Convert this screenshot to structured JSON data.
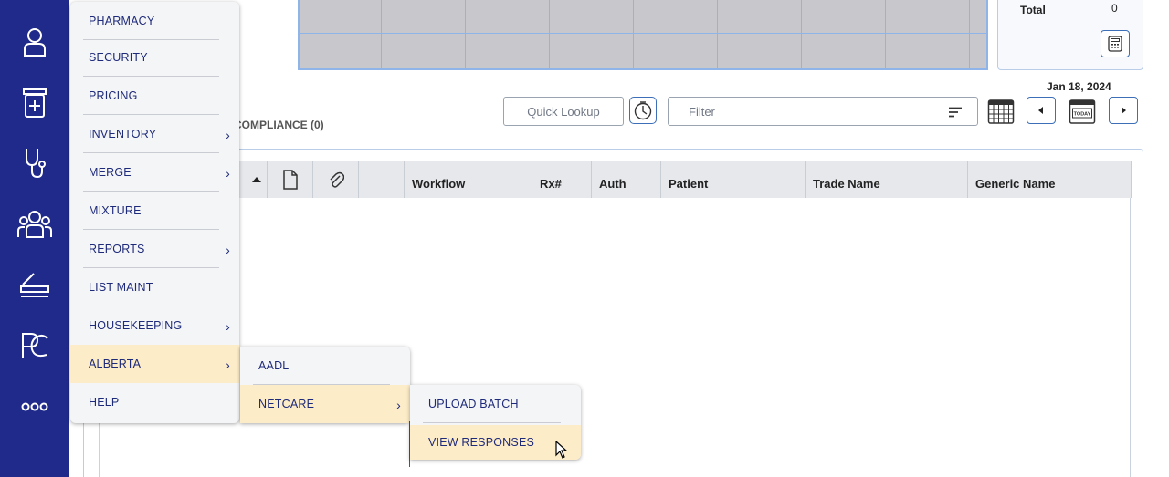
{
  "rail": {
    "items": [
      {
        "icon": "user-icon"
      },
      {
        "icon": "pharmacy-jar-icon"
      },
      {
        "icon": "stethoscope-icon"
      },
      {
        "icon": "group-icon"
      },
      {
        "icon": "scanner-icon"
      },
      {
        "icon": "pc-logo-icon"
      },
      {
        "icon": "more-dots-icon"
      }
    ]
  },
  "summary": {
    "total_label": "Total",
    "total_value": "0",
    "calc_icon": "calculator-icon"
  },
  "toolbar": {
    "quick_lookup_placeholder": "Quick Lookup",
    "filter_placeholder": "Filter",
    "date": "Jan 18, 2024",
    "today_label": "TODAY"
  },
  "tabs": {
    "compliance": "COMPLIANCE (0)"
  },
  "table": {
    "headers": [
      "Workflow",
      "Rx#",
      "Auth",
      "Patient",
      "Trade Name",
      "Generic Name"
    ]
  },
  "main_menu": {
    "items": [
      {
        "label": "PHARMACY",
        "has_submenu": false
      },
      {
        "label": "SECURITY",
        "has_submenu": false
      },
      {
        "label": "PRICING",
        "has_submenu": false
      },
      {
        "label": "INVENTORY",
        "has_submenu": true
      },
      {
        "label": "MERGE",
        "has_submenu": true
      },
      {
        "label": "MIXTURE",
        "has_submenu": false
      },
      {
        "label": "REPORTS",
        "has_submenu": true
      },
      {
        "label": "LIST MAINT",
        "has_submenu": false
      },
      {
        "label": "HOUSEKEEPING",
        "has_submenu": true
      },
      {
        "label": "ALBERTA",
        "has_submenu": true,
        "active": true
      },
      {
        "label": "HELP",
        "has_submenu": false
      }
    ]
  },
  "alberta_menu": {
    "items": [
      {
        "label": "AADL",
        "has_submenu": false
      },
      {
        "label": "NETCARE",
        "has_submenu": true,
        "active": true
      }
    ]
  },
  "netcare_menu": {
    "items": [
      {
        "label": "UPLOAD BATCH"
      },
      {
        "label": "VIEW RESPONSES",
        "hovered": true
      }
    ]
  },
  "colors": {
    "rail": "#1f2a8a",
    "menu_text": "#1e2a7a",
    "active_highlight": "#fdecc8",
    "accent_border": "#3d6fb8"
  }
}
